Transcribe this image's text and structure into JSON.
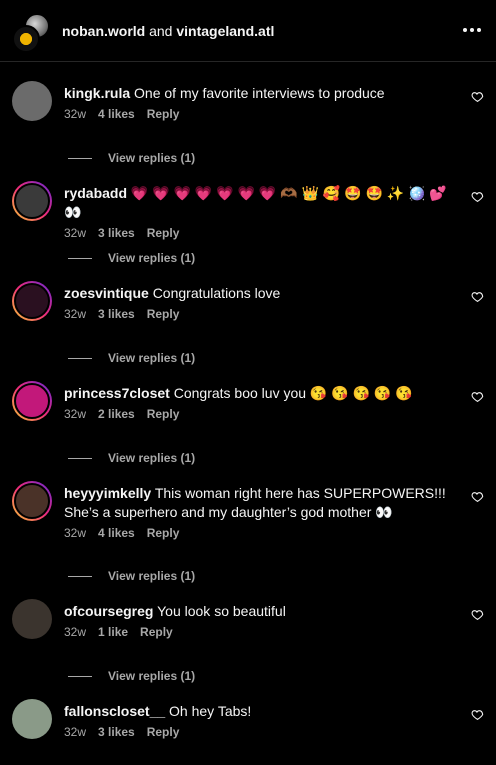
{
  "header": {
    "user1": "noban.world",
    "and_text": "and",
    "user2": "vintageland.atl"
  },
  "comments": [
    {
      "user": "kingk.rula",
      "text": "One of my favorite interviews to produce",
      "time": "32w",
      "likes": "4 likes",
      "reply": "Reply",
      "view_replies": "View replies (1)",
      "avatar_color": "#6b6b6b"
    },
    {
      "user": "rydabadd",
      "text": "💗 💗 💗 💗 💗 💗 💗 🫶🏾 👑 🥰 🤩 🤩 ✨ 🪩 💕 👀",
      "time": "32w",
      "likes": "3 likes",
      "reply": "Reply",
      "view_replies": "View replies (1)",
      "avatar_color": "#3a3a3a"
    },
    {
      "user": "zoesvintique",
      "text": "Congratulations love",
      "time": "32w",
      "likes": "3 likes",
      "reply": "Reply",
      "view_replies": "View replies (1)",
      "avatar_color": "#2a1020"
    },
    {
      "user": "princess7closet",
      "text": "Congrats boo luv you 😘 😘 😘 😘 😘",
      "time": "32w",
      "likes": "2 likes",
      "reply": "Reply",
      "view_replies": "View replies (1)",
      "avatar_color": "#c2187a"
    },
    {
      "user": "heyyyimkelly",
      "text": "This woman right here has SUPERPOWERS!!! She’s a superhero and my daughter’s god mother 👀",
      "time": "32w",
      "likes": "4 likes",
      "reply": "Reply",
      "view_replies": "View replies (1)",
      "avatar_color": "#4a3228"
    },
    {
      "user": "ofcoursegreg",
      "text": "You look so beautiful",
      "time": "32w",
      "likes": "1 like",
      "reply": "Reply",
      "view_replies": "View replies (1)",
      "avatar_color": "#3b342e"
    },
    {
      "user": "fallonscloset__",
      "text": "Oh hey Tabs!",
      "time": "32w",
      "likes": "3 likes",
      "reply": "Reply",
      "view_replies": "",
      "avatar_color": "#8a9a88"
    }
  ]
}
